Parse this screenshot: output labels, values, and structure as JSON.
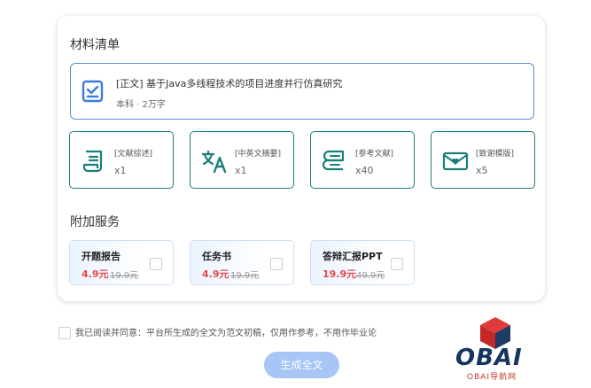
{
  "materials_section": {
    "title": "材料清单"
  },
  "main_document": {
    "title": "[正文] 基于Java多线程技术的项目进度并行仿真研究",
    "subtitle": "本科 · 2万字"
  },
  "materials": [
    {
      "label": "[文献综述]",
      "count": "x1",
      "icon": "document-scroll-icon"
    },
    {
      "label": "[中英文摘要]",
      "count": "x1",
      "icon": "translate-icon"
    },
    {
      "label": "[参考文献]",
      "count": "x40",
      "icon": "reference-book-icon"
    },
    {
      "label": "[致谢模版]",
      "count": "x5",
      "icon": "thank-you-envelope-icon"
    }
  ],
  "services_section": {
    "title": "附加服务"
  },
  "services": [
    {
      "name": "开题报告",
      "price": "4.9元",
      "original_price": "19.9元"
    },
    {
      "name": "任务书",
      "price": "4.9元",
      "original_price": "19.9元"
    },
    {
      "name": "答辩汇报PPT",
      "price": "19.9元",
      "original_price": "49.9元"
    }
  ],
  "agreement": {
    "text": "我已阅读并同意：平台所生成的全文为范文初稿，仅用作参考，不用作毕业论"
  },
  "generate_button": {
    "label": "生成全文"
  },
  "watermark": {
    "brand": "OBAI",
    "subtitle": "OBAI导航网"
  },
  "colors": {
    "accent": "#1a7f7a",
    "primary_blue": "#5b8bd6",
    "price_red": "#e5484d",
    "button_disabled": "#a7c5f5"
  }
}
